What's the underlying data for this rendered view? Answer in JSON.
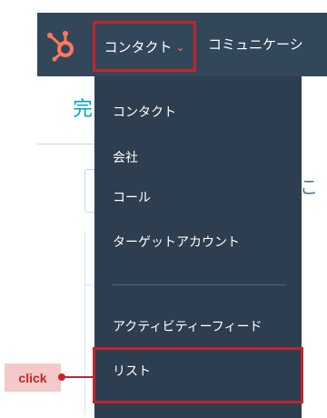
{
  "colors": {
    "nav_bg": "#33475b",
    "menu_bg": "#2d3e50",
    "accent": "#ff7a59",
    "highlight": "#c0262b"
  },
  "nav": {
    "logo_icon": "hubspot-sprocket-icon",
    "contacts_label": "コンタクト",
    "contacts_chevron": "chevron-down-icon",
    "communications_label": "コミュニケーシ"
  },
  "background": {
    "title_fragment": "完",
    "right_fragment": "こ"
  },
  "menu": {
    "items": [
      {
        "label": "コンタクト"
      },
      {
        "label": "会社"
      },
      {
        "label": "コール"
      },
      {
        "label": "ターゲットアカウント"
      },
      {
        "label": "アクティビティーフィード"
      },
      {
        "label": "リスト"
      }
    ]
  },
  "annotation": {
    "click_label": "click"
  }
}
